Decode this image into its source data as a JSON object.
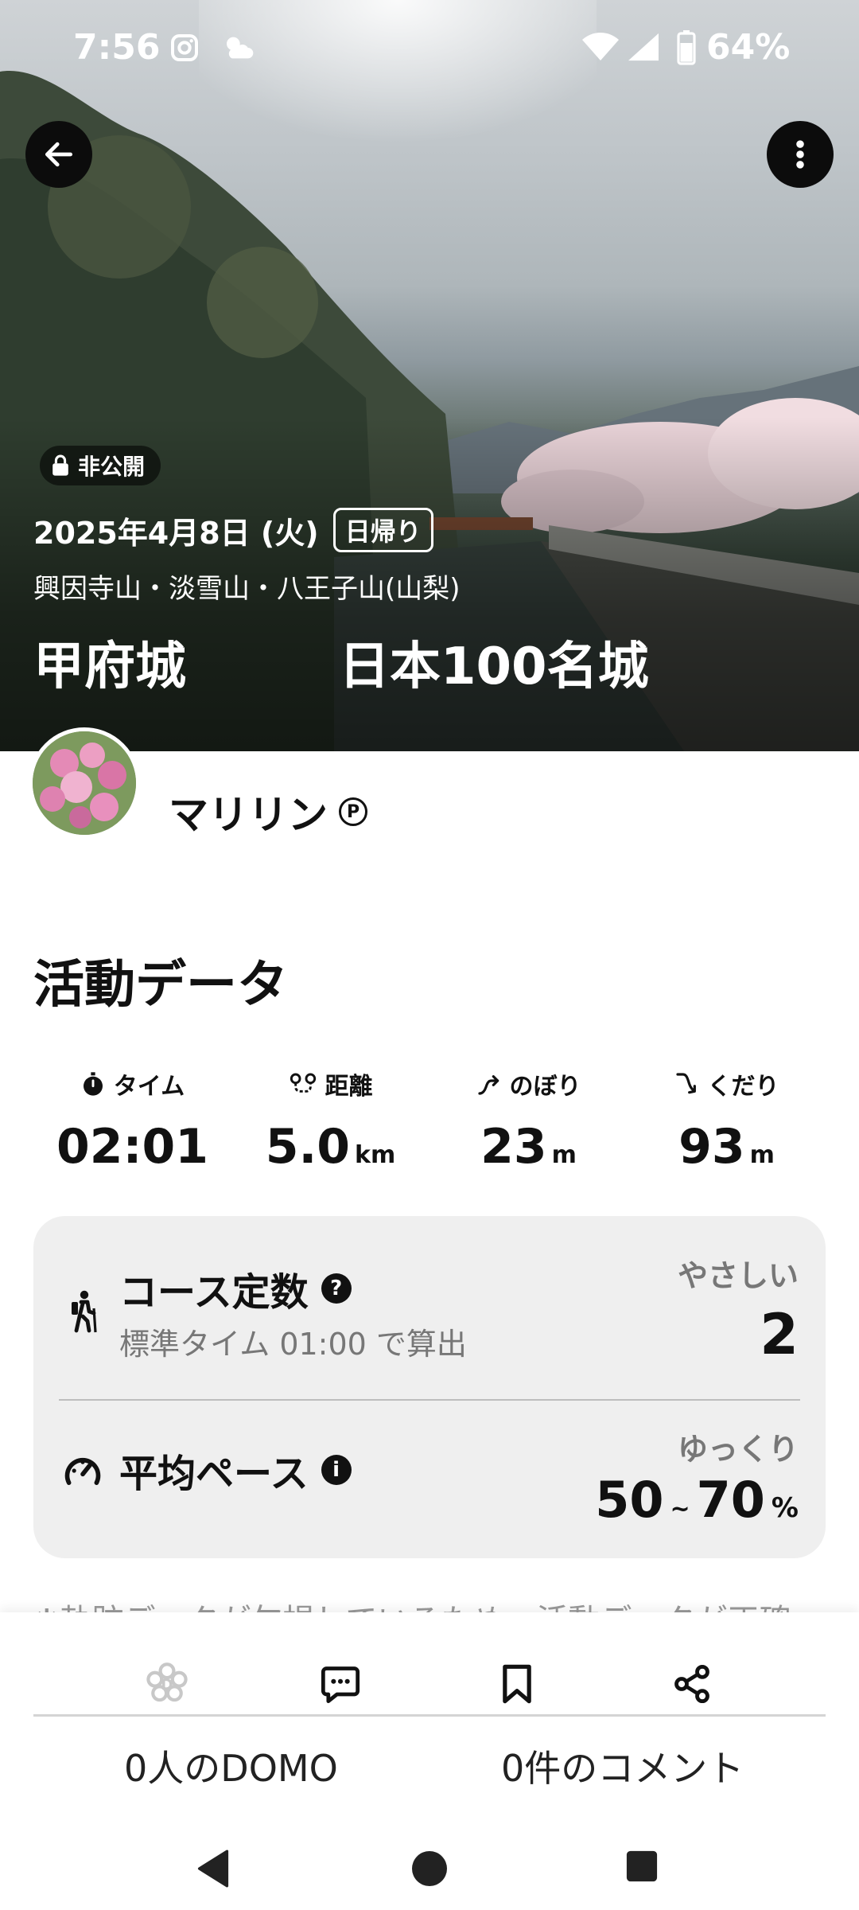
{
  "status_bar": {
    "time": "7:56",
    "battery": "64%"
  },
  "hero": {
    "privacy_label": "非公開",
    "date": "2025年4月8日 (火)",
    "trip_type": "日帰り",
    "mountains": "興因寺山・淡雪山・八王子山(山梨)",
    "title": "甲府城　　　日本100名城"
  },
  "user": {
    "name": "マリリン",
    "badge": "P"
  },
  "activity": {
    "section_title": "活動データ",
    "stats": [
      {
        "label": "タイム",
        "value": "02:01",
        "unit": "",
        "icon": "stopwatch-icon"
      },
      {
        "label": "距離",
        "value": "5.0",
        "unit": "km",
        "icon": "route-icon"
      },
      {
        "label": "のぼり",
        "value": "23",
        "unit": "m",
        "icon": "ascent-icon"
      },
      {
        "label": "くだり",
        "value": "93",
        "unit": "m",
        "icon": "descent-icon"
      }
    ],
    "course": {
      "title": "コース定数",
      "subtitle": "標準タイム 01:00 で算出",
      "level": "やさしい",
      "value": "2"
    },
    "pace": {
      "title": "平均ペース",
      "level": "ゆっくり",
      "min": "50",
      "tilde": "~",
      "max": "70",
      "unit": "%"
    },
    "note": "※軌跡データが欠損しているため、活動データが正確"
  },
  "footer": {
    "domo_count": "0人のDOMO",
    "comment_count": "0件のコメント"
  }
}
